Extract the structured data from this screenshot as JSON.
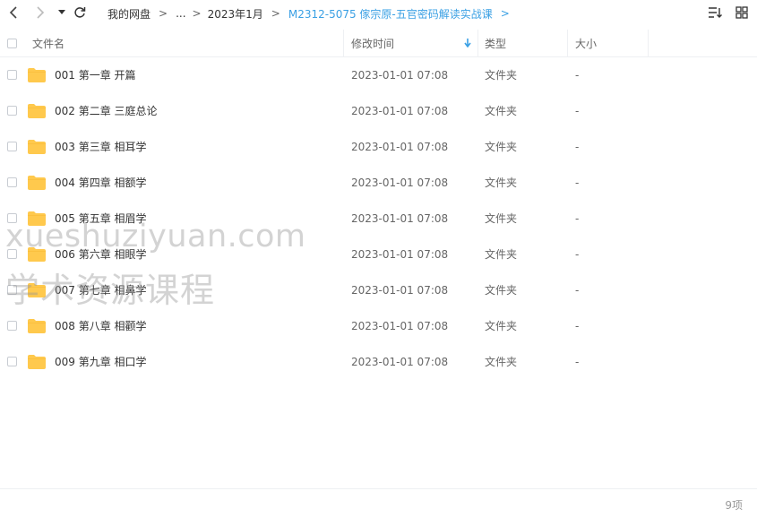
{
  "breadcrumb": {
    "items": [
      "我的网盘",
      "...",
      "2023年1月"
    ],
    "current": "M2312-5075 傢宗原-五官密码解读实战课",
    "separator": ">"
  },
  "columns": {
    "name": "文件名",
    "mtime": "修改时间",
    "type": "类型",
    "size": "大小"
  },
  "files": [
    {
      "name": "001 第一章 开篇",
      "mtime": "2023-01-01 07:08",
      "type": "文件夹",
      "size": "-"
    },
    {
      "name": "002 第二章 三庭总论",
      "mtime": "2023-01-01 07:08",
      "type": "文件夹",
      "size": "-"
    },
    {
      "name": "003 第三章 相耳学",
      "mtime": "2023-01-01 07:08",
      "type": "文件夹",
      "size": "-"
    },
    {
      "name": "004 第四章 相额学",
      "mtime": "2023-01-01 07:08",
      "type": "文件夹",
      "size": "-"
    },
    {
      "name": "005 第五章 相眉学",
      "mtime": "2023-01-01 07:08",
      "type": "文件夹",
      "size": "-"
    },
    {
      "name": "006 第六章 相眼学",
      "mtime": "2023-01-01 07:08",
      "type": "文件夹",
      "size": "-"
    },
    {
      "name": "007 第七章 相鼻学",
      "mtime": "2023-01-01 07:08",
      "type": "文件夹",
      "size": "-"
    },
    {
      "name": "008 第八章 相颧学",
      "mtime": "2023-01-01 07:08",
      "type": "文件夹",
      "size": "-"
    },
    {
      "name": "009 第九章 相口学",
      "mtime": "2023-01-01 07:08",
      "type": "文件夹",
      "size": "-"
    }
  ],
  "footer": {
    "count": "9项"
  },
  "watermark": {
    "line1": "xueshuziyuan.com",
    "line2": "学术资源课程"
  },
  "colors": {
    "accent": "#3aa0e4",
    "folder": "#ffc94d",
    "folder_tab": "#f7b731"
  },
  "icons": [
    "back-arrow-icon",
    "forward-arrow-icon",
    "dropdown-icon",
    "refresh-icon",
    "sort-icon",
    "grid-view-icon",
    "folder-icon",
    "sort-down-icon"
  ]
}
